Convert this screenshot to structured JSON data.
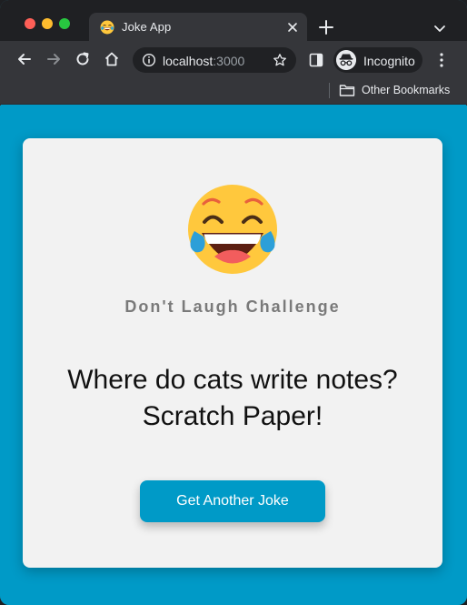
{
  "browser": {
    "tab": {
      "title": "Joke App",
      "favicon": "laughing-emoji-icon"
    },
    "address_bar": {
      "host": "localhost",
      "port": ":3000"
    },
    "profile": {
      "label": "Incognito"
    },
    "bookmarks_bar": {
      "other_bookmarks_label": "Other Bookmarks"
    }
  },
  "page": {
    "background_color": "#009ac7",
    "card": {
      "emoji_icon": "laughing-with-tears-emoji-icon",
      "heading": "Don't Laugh Challenge",
      "joke": {
        "setup": "Where do cats write notes?",
        "punchline": "Scratch Paper!"
      },
      "button_label": "Get Another Joke",
      "accent_color": "#009ac7"
    }
  }
}
